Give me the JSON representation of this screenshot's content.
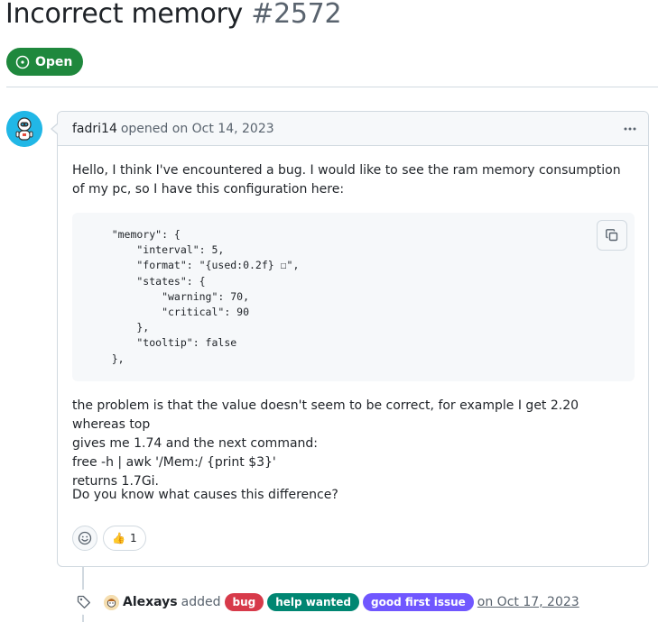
{
  "issue": {
    "title": "Incorrect memory",
    "number": "#2572",
    "state": "Open"
  },
  "comment": {
    "author": "fadri14",
    "opened_text": "opened on Oct 14, 2023",
    "paragraph1": "Hello, I think I've encountered a bug. I would like to see the ram memory consumption of my pc, so I have this configuration here:",
    "code": "    \"memory\": {\n        \"interval\": 5,\n        \"format\": \"{used:0.2f} ☐\",\n        \"states\": {\n            \"warning\": 70,\n            \"critical\": 90\n        },\n        \"tooltip\": false\n    },",
    "paragraph2_lines": [
      "the problem is that the value doesn't seem to be correct, for example I get 2.20 whereas top",
      "gives me 1.74 and the next command:",
      "free -h | awk '/Mem:/ {print $3}'",
      "returns 1.7Gi."
    ],
    "paragraph3": "Do you know what causes this difference?",
    "reactions": [
      {
        "icon": "thumbs-up-icon",
        "emoji": "👍",
        "count": "1"
      }
    ]
  },
  "event": {
    "actor": "Alexays",
    "action": "added",
    "labels": [
      {
        "name": "bug",
        "color": "#d73a4a"
      },
      {
        "name": "help wanted",
        "color": "#008672"
      },
      {
        "name": "good first issue",
        "color": "#7057ff"
      }
    ],
    "date": "on Oct 17, 2023"
  },
  "colors": {
    "open_green": "#1f883d",
    "border": "#d1d9e0",
    "muted_text": "#59636e"
  }
}
